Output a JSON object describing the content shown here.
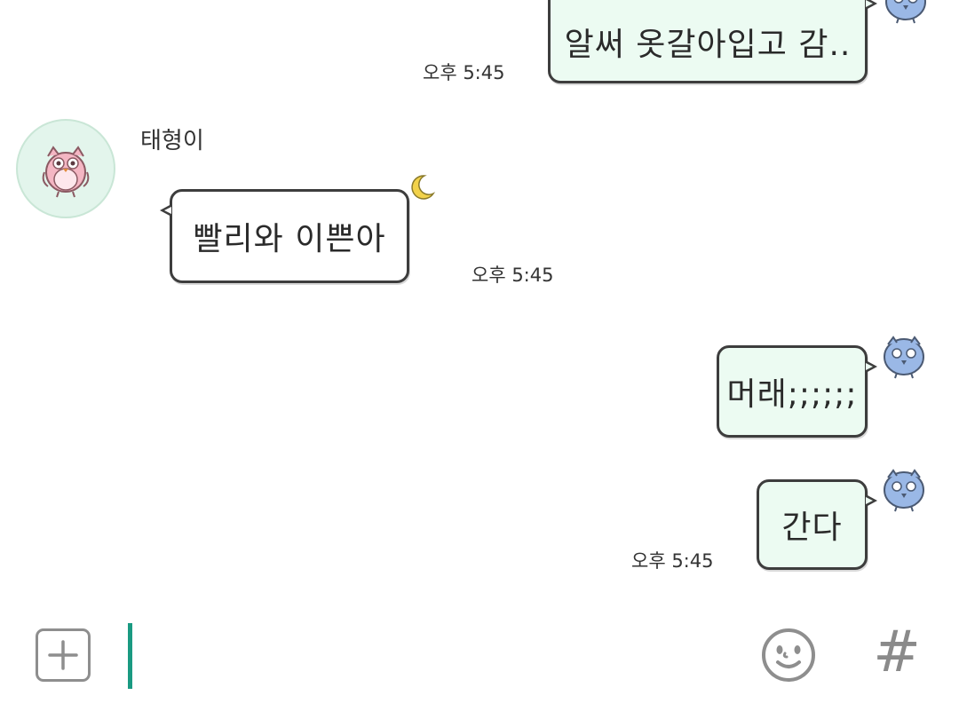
{
  "messages": [
    {
      "id": "m1",
      "direction": "sent",
      "text": "알써 옷갈아입고 감..",
      "time": "오후 5:45"
    },
    {
      "id": "m2",
      "direction": "received",
      "sender": "태형이",
      "text": "빨리와 이쁜아",
      "time": "오후 5:45"
    },
    {
      "id": "m3",
      "direction": "sent",
      "text": "머래;;;;;;",
      "time": ""
    },
    {
      "id": "m4",
      "direction": "sent",
      "text": "간다",
      "time": "오후 5:45"
    }
  ],
  "composer": {
    "input_value": "",
    "plus_icon": "plus-icon",
    "emoji_icon": "smiley-icon",
    "hash_label": "#"
  },
  "colors": {
    "sent_bubble": "#ecfbf2",
    "received_bubble": "#ffffff",
    "cursor": "#1a9a82",
    "avatar_bg": "#e3f5ec",
    "icon_gray": "#8a8a8a"
  }
}
